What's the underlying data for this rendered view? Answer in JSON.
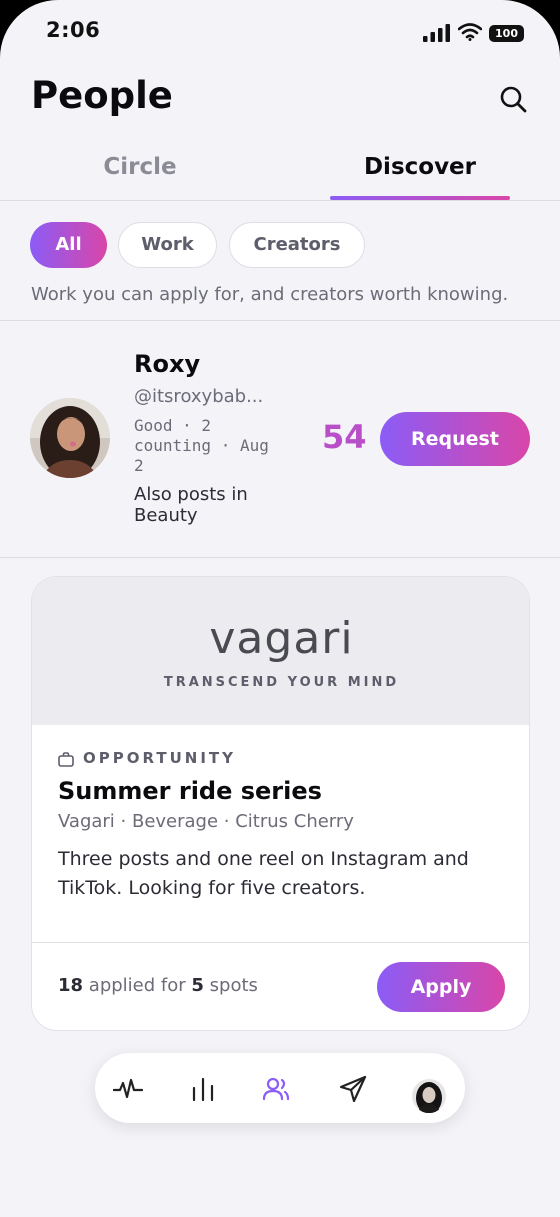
{
  "status_bar": {
    "time": "2:06",
    "battery": "100",
    "icons": [
      "signal-icon",
      "wifi-icon",
      "battery-icon"
    ]
  },
  "header": {
    "title": "People",
    "search_icon": "search-icon"
  },
  "tabs": [
    {
      "label": "Circle",
      "active": false
    },
    {
      "label": "Discover",
      "active": true
    }
  ],
  "filters": {
    "chips": [
      {
        "label": "All",
        "selected": true
      },
      {
        "label": "Work",
        "selected": false
      },
      {
        "label": "Creators",
        "selected": false
      }
    ],
    "description": "Work you can apply for, and creators worth knowing."
  },
  "person": {
    "name": "Roxy",
    "handle": "@itsroxybab...",
    "meta": "Good · 2 counting · Aug 2",
    "also": "Also posts in Beauty",
    "score": "54",
    "action_label": "Request"
  },
  "opportunity": {
    "brand_logo": "vagari",
    "brand_tagline": "TRANSCEND YOUR MIND",
    "label": "OPPORTUNITY",
    "title": "Summer ride series",
    "meta": "Vagari · Beverage · Citrus Cherry",
    "description": "Three posts and one reel on Instagram and TikTok. Looking for five creators.",
    "applied_count": "18",
    "applied_mid": "applied for",
    "spots_count": "5",
    "spots_label": "spots",
    "action_label": "Apply"
  },
  "bottom_nav": {
    "items": [
      "activity-icon",
      "stats-icon",
      "people-icon",
      "send-icon",
      "profile-avatar"
    ],
    "active": "people-icon"
  },
  "colors": {
    "accent_start": "#8b5cf6",
    "accent_end": "#d946a8",
    "score": "#b84fc9",
    "background": "#f4f4f8"
  }
}
